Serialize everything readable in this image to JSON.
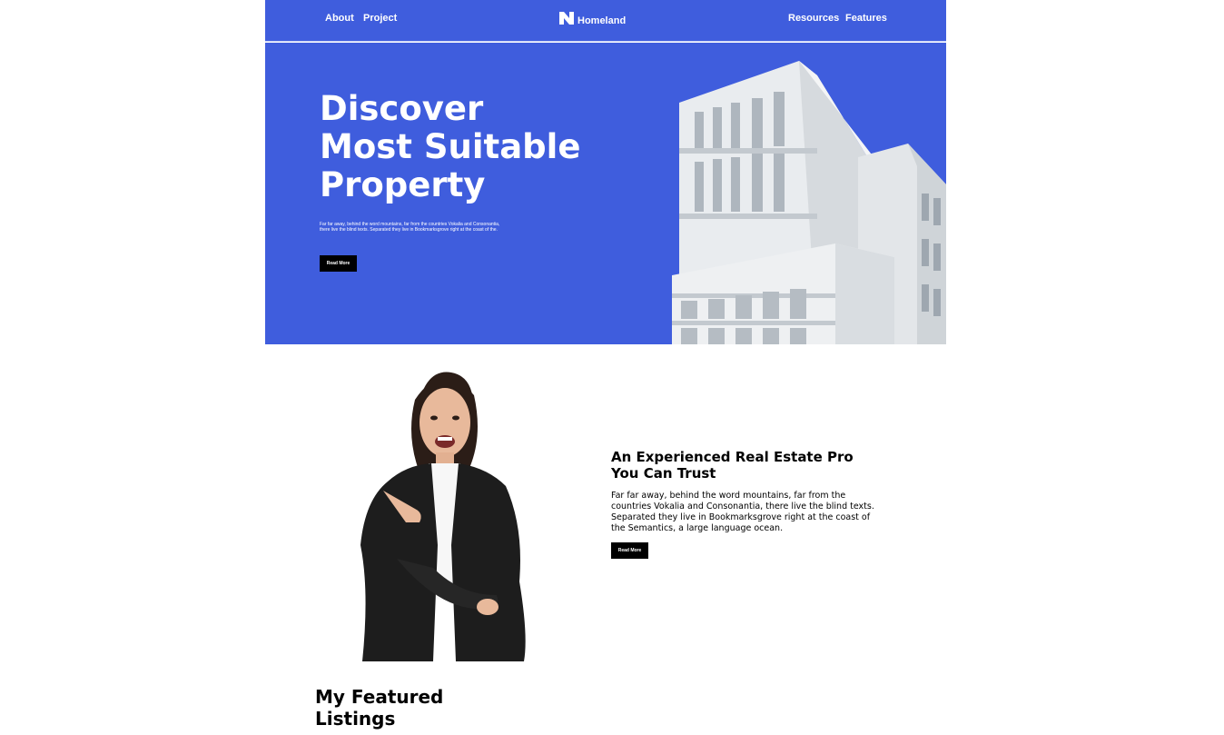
{
  "header": {
    "nav_left": [
      "About",
      "Project"
    ],
    "nav_right": [
      "Resources",
      "Features"
    ],
    "logo_text": "Homeland",
    "logo_icon": "n-logo-icon",
    "background": "#3f5ddd"
  },
  "hero": {
    "title_lines": [
      "Discover",
      "Most Suitable",
      "Property"
    ],
    "text": "Far far away, behind the word mountains, far from the countries Vokalia and Consonantia, there live the blind texts. Separated they live in Bookmarksgrove right at the coast of the.",
    "button_label": "Read More",
    "image": "white-modern-building-image"
  },
  "about": {
    "image": "smiling-real-estate-agent-image",
    "title": "An Experienced Real Estate Pro You Can Trust",
    "text": "Far far away, behind the word mountains, far from the countries Vokalia and Consonantia, there live the blind texts. Separated they live in Bookmarksgrove right at the coast of the Semantics, a large language ocean.",
    "button_label": "Read More"
  },
  "featured": {
    "title": "My Featured Listings"
  },
  "colors": {
    "brand_blue": "#3f5ddd",
    "button_black": "#000000",
    "text_white": "#ffffff"
  }
}
